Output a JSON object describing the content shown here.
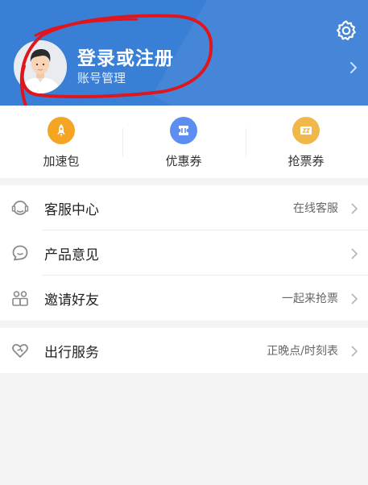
{
  "profile": {
    "title": "登录或注册",
    "subtitle": "账号管理"
  },
  "icons": {
    "settings": "gear-icon",
    "header_chevron": "chevron-right-icon"
  },
  "colors": {
    "header_bg": "#3a7fd6",
    "accent_orange": "#f5a524",
    "accent_blue": "#5b8ef0",
    "accent_gold": "#f0b84a",
    "annotation_red": "#e0161e"
  },
  "quick_actions": [
    {
      "label": "加速包",
      "icon": "rocket-icon"
    },
    {
      "label": "优惠券",
      "icon": "coupon-icon"
    },
    {
      "label": "抢票券",
      "icon": "ticket-icon"
    }
  ],
  "menu_group_1": [
    {
      "label": "客服中心",
      "value": "在线客服",
      "icon": "headset-icon"
    },
    {
      "label": "产品意见",
      "value": "",
      "icon": "feedback-icon"
    },
    {
      "label": "邀请好友",
      "value": "一起来抢票",
      "icon": "invite-friends-icon"
    }
  ],
  "menu_group_2": [
    {
      "label": "出行服务",
      "value": "正晚点/时刻表",
      "icon": "heart-icon"
    }
  ]
}
